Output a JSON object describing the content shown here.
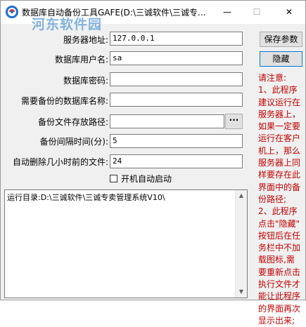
{
  "window": {
    "title": "数据库自动备份工具GAFE(D:\\三诚软件\\三诚专...",
    "watermark": "河东软件园",
    "minimize_glyph": "—",
    "maximize_glyph": "☐",
    "close_glyph": "✕"
  },
  "form": {
    "server_label": "服务器地址:",
    "server_value": "127.0.0.1",
    "user_label": "数据库用户名:",
    "user_value": "sa",
    "password_label": "数据库密码:",
    "password_value": "",
    "dbname_label": "需要备份的数据库名称:",
    "dbname_value": "",
    "path_label": "备份文件存放路径:",
    "path_value": "",
    "browse_label": "···",
    "interval_label": "备份间隔时间(分):",
    "interval_value": "5",
    "autodelete_label": "自动删除几小时前的文件:",
    "autodelete_value": "24",
    "autostart_label": "开机自动启动",
    "autostart_checked": false
  },
  "log": {
    "text": "运行目录:D:\\三诚软件\\三诚专卖管理系统V10\\"
  },
  "side": {
    "save_label": "保存参数",
    "hide_label": "隐藏",
    "notice_lines": [
      "请注意:",
      "1、此程序",
      "建议运行在",
      "服务器上，",
      "如果一定要",
      "运行在客户",
      "机上，那么",
      "服务器上同",
      "样要存在此",
      "界面中的备",
      "份路径;",
      "2、此程序",
      "点击\"隐藏\"",
      "按钮后在任",
      "务栏中不加",
      "载图标,需",
      "要重新点击",
      "执行文件才",
      "能让此程序",
      "的界面再次",
      "显示出来;"
    ]
  },
  "colors": {
    "notice_text": "#c00000",
    "watermark": "#5b9bd5",
    "focus_border": "#0078d7"
  }
}
